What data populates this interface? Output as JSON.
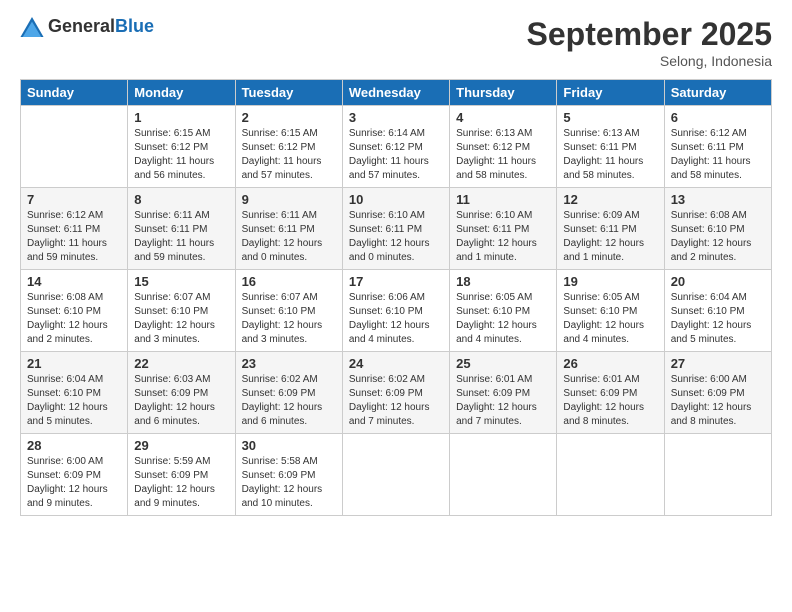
{
  "logo": {
    "general": "General",
    "blue": "Blue"
  },
  "title": "September 2025",
  "location": "Selong, Indonesia",
  "days_header": [
    "Sunday",
    "Monday",
    "Tuesday",
    "Wednesday",
    "Thursday",
    "Friday",
    "Saturday"
  ],
  "weeks": [
    [
      {
        "day": "",
        "info": ""
      },
      {
        "day": "1",
        "info": "Sunrise: 6:15 AM\nSunset: 6:12 PM\nDaylight: 11 hours\nand 56 minutes."
      },
      {
        "day": "2",
        "info": "Sunrise: 6:15 AM\nSunset: 6:12 PM\nDaylight: 11 hours\nand 57 minutes."
      },
      {
        "day": "3",
        "info": "Sunrise: 6:14 AM\nSunset: 6:12 PM\nDaylight: 11 hours\nand 57 minutes."
      },
      {
        "day": "4",
        "info": "Sunrise: 6:13 AM\nSunset: 6:12 PM\nDaylight: 11 hours\nand 58 minutes."
      },
      {
        "day": "5",
        "info": "Sunrise: 6:13 AM\nSunset: 6:11 PM\nDaylight: 11 hours\nand 58 minutes."
      },
      {
        "day": "6",
        "info": "Sunrise: 6:12 AM\nSunset: 6:11 PM\nDaylight: 11 hours\nand 58 minutes."
      }
    ],
    [
      {
        "day": "7",
        "info": "Sunrise: 6:12 AM\nSunset: 6:11 PM\nDaylight: 11 hours\nand 59 minutes."
      },
      {
        "day": "8",
        "info": "Sunrise: 6:11 AM\nSunset: 6:11 PM\nDaylight: 11 hours\nand 59 minutes."
      },
      {
        "day": "9",
        "info": "Sunrise: 6:11 AM\nSunset: 6:11 PM\nDaylight: 12 hours\nand 0 minutes."
      },
      {
        "day": "10",
        "info": "Sunrise: 6:10 AM\nSunset: 6:11 PM\nDaylight: 12 hours\nand 0 minutes."
      },
      {
        "day": "11",
        "info": "Sunrise: 6:10 AM\nSunset: 6:11 PM\nDaylight: 12 hours\nand 1 minute."
      },
      {
        "day": "12",
        "info": "Sunrise: 6:09 AM\nSunset: 6:11 PM\nDaylight: 12 hours\nand 1 minute."
      },
      {
        "day": "13",
        "info": "Sunrise: 6:08 AM\nSunset: 6:10 PM\nDaylight: 12 hours\nand 2 minutes."
      }
    ],
    [
      {
        "day": "14",
        "info": "Sunrise: 6:08 AM\nSunset: 6:10 PM\nDaylight: 12 hours\nand 2 minutes."
      },
      {
        "day": "15",
        "info": "Sunrise: 6:07 AM\nSunset: 6:10 PM\nDaylight: 12 hours\nand 3 minutes."
      },
      {
        "day": "16",
        "info": "Sunrise: 6:07 AM\nSunset: 6:10 PM\nDaylight: 12 hours\nand 3 minutes."
      },
      {
        "day": "17",
        "info": "Sunrise: 6:06 AM\nSunset: 6:10 PM\nDaylight: 12 hours\nand 4 minutes."
      },
      {
        "day": "18",
        "info": "Sunrise: 6:05 AM\nSunset: 6:10 PM\nDaylight: 12 hours\nand 4 minutes."
      },
      {
        "day": "19",
        "info": "Sunrise: 6:05 AM\nSunset: 6:10 PM\nDaylight: 12 hours\nand 4 minutes."
      },
      {
        "day": "20",
        "info": "Sunrise: 6:04 AM\nSunset: 6:10 PM\nDaylight: 12 hours\nand 5 minutes."
      }
    ],
    [
      {
        "day": "21",
        "info": "Sunrise: 6:04 AM\nSunset: 6:10 PM\nDaylight: 12 hours\nand 5 minutes."
      },
      {
        "day": "22",
        "info": "Sunrise: 6:03 AM\nSunset: 6:09 PM\nDaylight: 12 hours\nand 6 minutes."
      },
      {
        "day": "23",
        "info": "Sunrise: 6:02 AM\nSunset: 6:09 PM\nDaylight: 12 hours\nand 6 minutes."
      },
      {
        "day": "24",
        "info": "Sunrise: 6:02 AM\nSunset: 6:09 PM\nDaylight: 12 hours\nand 7 minutes."
      },
      {
        "day": "25",
        "info": "Sunrise: 6:01 AM\nSunset: 6:09 PM\nDaylight: 12 hours\nand 7 minutes."
      },
      {
        "day": "26",
        "info": "Sunrise: 6:01 AM\nSunset: 6:09 PM\nDaylight: 12 hours\nand 8 minutes."
      },
      {
        "day": "27",
        "info": "Sunrise: 6:00 AM\nSunset: 6:09 PM\nDaylight: 12 hours\nand 8 minutes."
      }
    ],
    [
      {
        "day": "28",
        "info": "Sunrise: 6:00 AM\nSunset: 6:09 PM\nDaylight: 12 hours\nand 9 minutes."
      },
      {
        "day": "29",
        "info": "Sunrise: 5:59 AM\nSunset: 6:09 PM\nDaylight: 12 hours\nand 9 minutes."
      },
      {
        "day": "30",
        "info": "Sunrise: 5:58 AM\nSunset: 6:09 PM\nDaylight: 12 hours\nand 10 minutes."
      },
      {
        "day": "",
        "info": ""
      },
      {
        "day": "",
        "info": ""
      },
      {
        "day": "",
        "info": ""
      },
      {
        "day": "",
        "info": ""
      }
    ]
  ]
}
